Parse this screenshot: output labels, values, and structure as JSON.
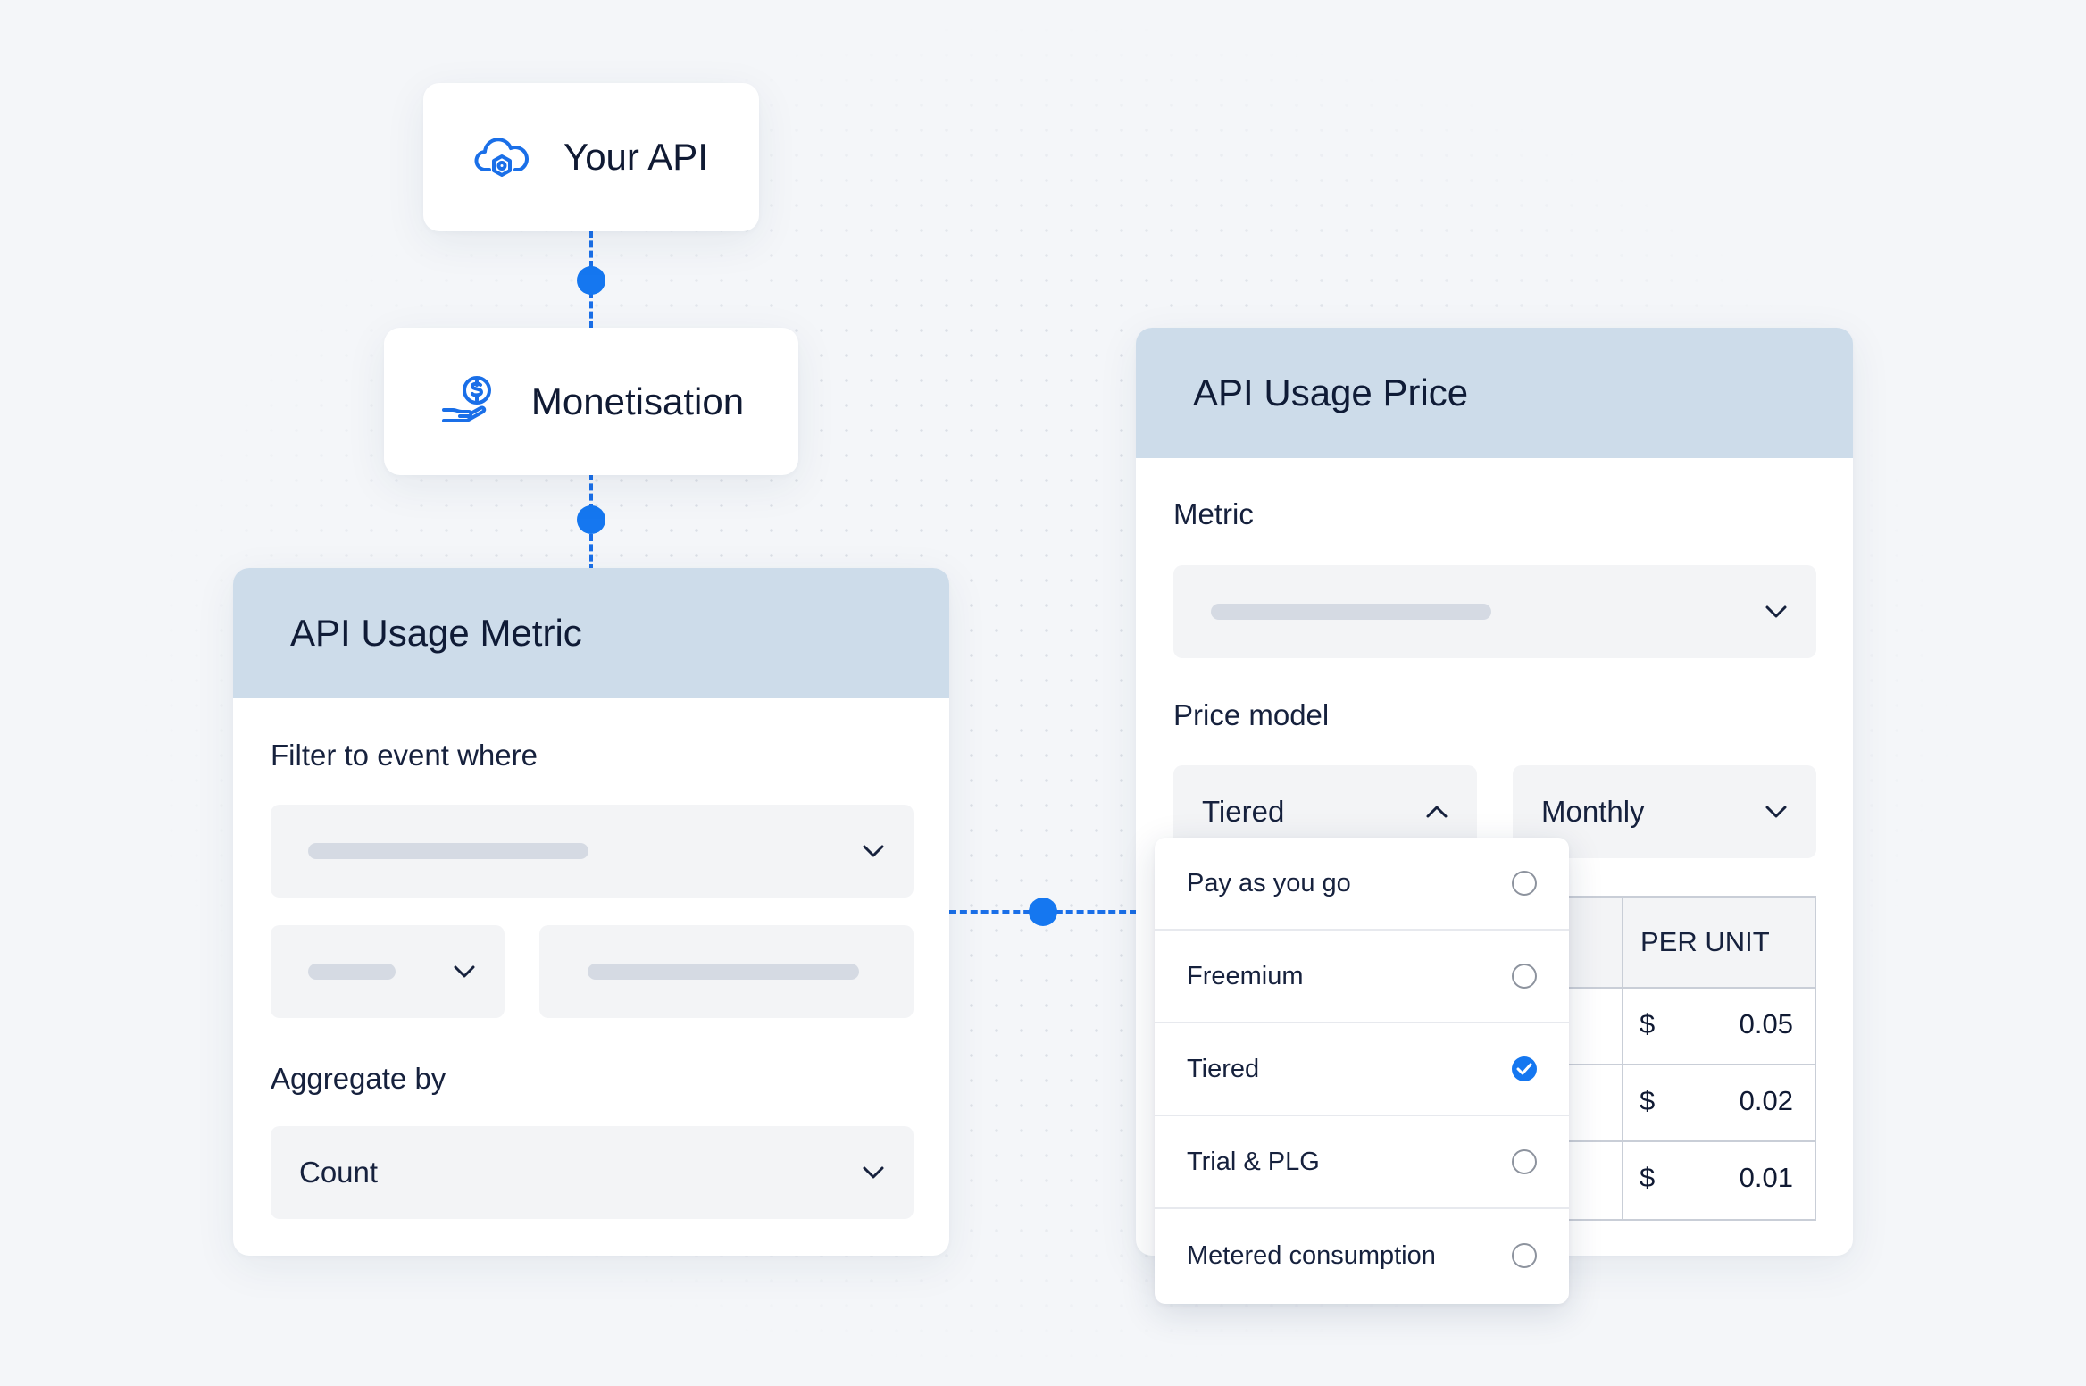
{
  "flow": {
    "api_node": {
      "label": "Your API",
      "icon": "cloud-hexagon-icon"
    },
    "monetisation_node": {
      "label": "Monetisation",
      "icon": "hand-coin-icon"
    }
  },
  "metric_panel": {
    "title": "API Usage Metric",
    "filter_label": "Filter to event where",
    "aggregate_label": "Aggregate by",
    "aggregate_value": "Count"
  },
  "price_panel": {
    "title": "API Usage Price",
    "metric_label": "Metric",
    "price_model_label": "Price model",
    "price_model_value": "Tiered",
    "period_value": "Monthly",
    "table": {
      "header": "PER UNIT",
      "currency": "$",
      "rows": [
        "0.05",
        "0.02",
        "0.01"
      ]
    }
  },
  "price_model_dropdown": {
    "options": [
      {
        "label": "Pay as you go",
        "selected": false
      },
      {
        "label": "Freemium",
        "selected": false
      },
      {
        "label": "Tiered",
        "selected": true
      },
      {
        "label": "Trial & PLG",
        "selected": false
      },
      {
        "label": "Metered consumption",
        "selected": false
      }
    ]
  },
  "colors": {
    "accent": "#1577f0",
    "panel_header": "#cddcea",
    "field_bg": "#f3f4f6",
    "placeholder_bar": "#d5dae3"
  }
}
